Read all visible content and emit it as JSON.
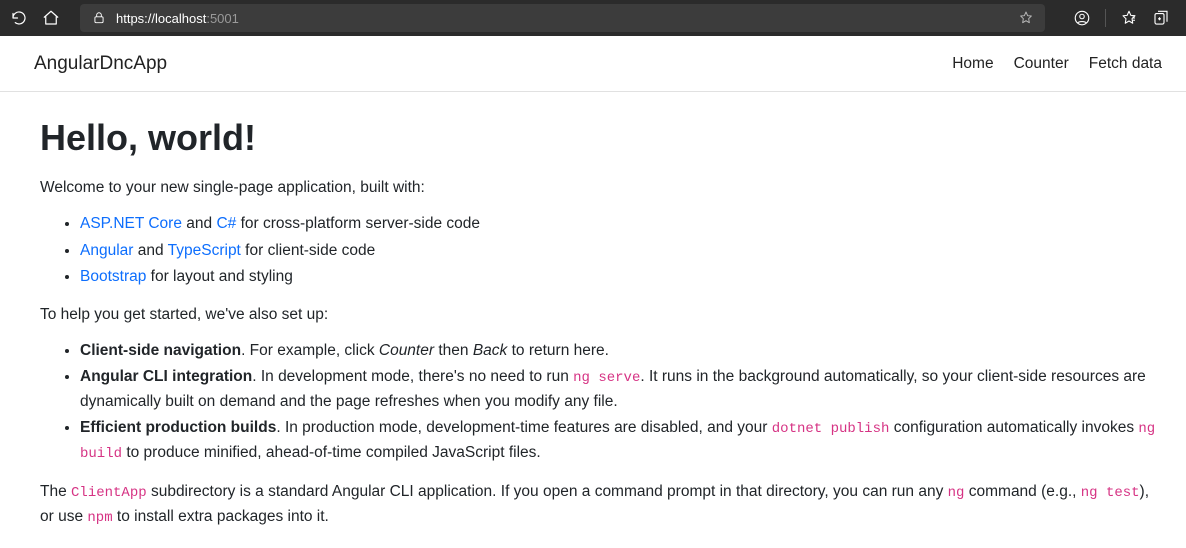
{
  "browser": {
    "url_proto": "https://",
    "url_host": "localhost",
    "url_port": ":5001"
  },
  "header": {
    "brand": "AngularDncApp",
    "nav": {
      "home": "Home",
      "counter": "Counter",
      "fetch": "Fetch data"
    }
  },
  "page": {
    "title": "Hello, world!",
    "intro": "Welcome to your new single-page application, built with:",
    "stack": {
      "aspnet_link": "ASP.NET Core",
      "aspnet_mid": " and ",
      "csharp_link": "C#",
      "aspnet_tail": " for cross-platform server-side code",
      "angular_link": "Angular",
      "angular_mid": " and ",
      "ts_link": "TypeScript",
      "angular_tail": " for client-side code",
      "bootstrap_link": "Bootstrap",
      "bootstrap_tail": " for layout and styling"
    },
    "setup_intro": "To help you get started, we've also set up:",
    "features": {
      "f1_bold": "Client-side navigation",
      "f1_t1": ". For example, click ",
      "f1_em1": "Counter",
      "f1_t2": " then ",
      "f1_em2": "Back",
      "f1_t3": " to return here.",
      "f2_bold": "Angular CLI integration",
      "f2_t1": ". In development mode, there's no need to run ",
      "f2_code1": "ng serve",
      "f2_t2": ". It runs in the background automatically, so your client-side resources are dynamically built on demand and the page refreshes when you modify any file.",
      "f3_bold": "Efficient production builds",
      "f3_t1": ". In production mode, development-time features are disabled, and your ",
      "f3_code1": "dotnet publish",
      "f3_t2": " configuration automatically invokes ",
      "f3_code2": "ng build",
      "f3_t3": " to produce minified, ahead-of-time compiled JavaScript files."
    },
    "footer": {
      "t1": "The ",
      "code1": "ClientApp",
      "t2": " subdirectory is a standard Angular CLI application. If you open a command prompt in that directory, you can run any ",
      "code2": "ng",
      "t3": " command (e.g., ",
      "code3": "ng test",
      "t4": "), or use ",
      "code4": "npm",
      "t5": " to install extra packages into it."
    }
  }
}
